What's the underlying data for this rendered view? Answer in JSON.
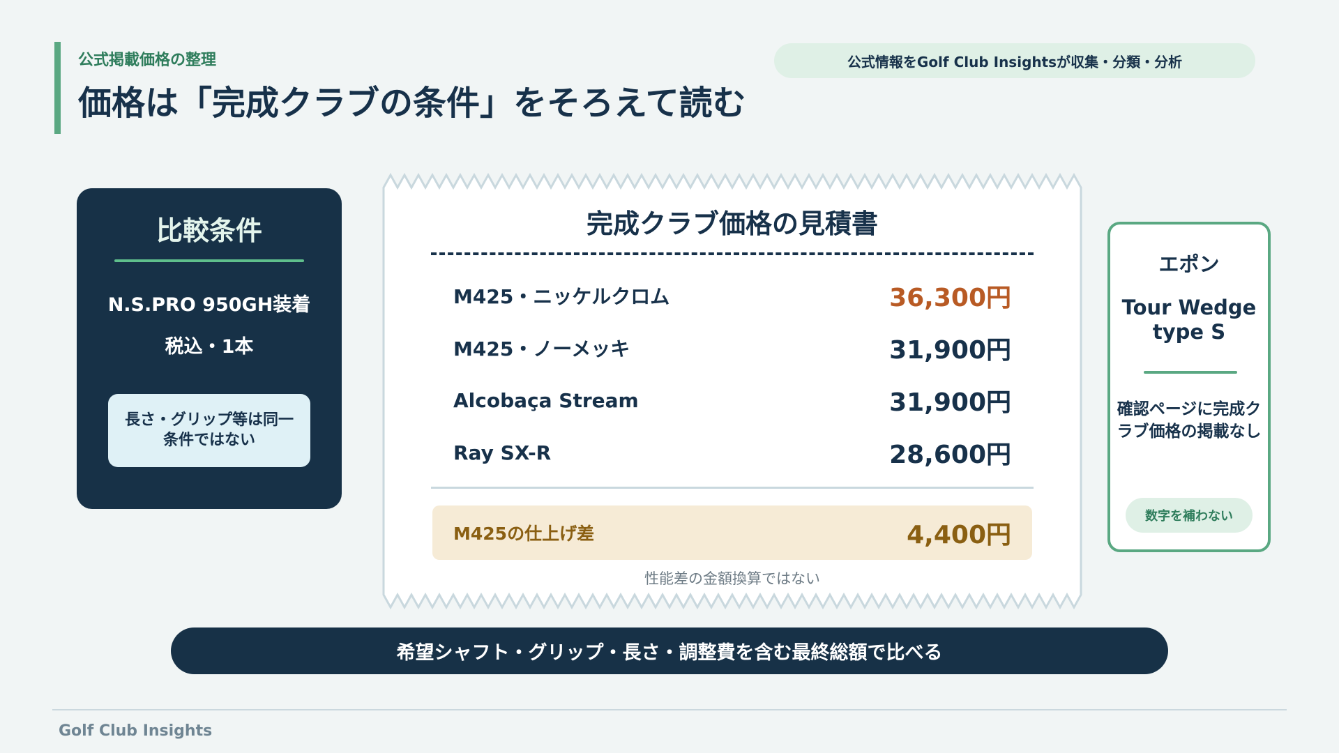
{
  "header": {
    "kicker": "公式掲載価格の整理",
    "title": "価格は「完成クラブの条件」をそろえて読む",
    "source_pill": "公式情報をGolf Club Insightsが収集・分類・分析"
  },
  "conditions": {
    "title": "比較条件",
    "lines": [
      "N.S.PRO 950GH装着",
      "税込・1本"
    ],
    "note": "長さ・グリップ等は同一条件ではない"
  },
  "receipt": {
    "title": "完成クラブ価格の見積書",
    "rows": [
      {
        "label": "M425・ニッケルクロム",
        "price": "36,300円"
      },
      {
        "label": "M425・ノーメッキ",
        "price": "31,900円"
      },
      {
        "label": "Alcobaça Stream",
        "price": "31,900円"
      },
      {
        "label": "Ray SX-R",
        "price": "28,600円"
      }
    ],
    "diff": {
      "label": "M425の仕上げ差",
      "value": "4,400円"
    },
    "diff_note": "性能差の金額換算ではない"
  },
  "epon": {
    "brand": "エポン",
    "model": "Tour Wedge type S",
    "note": "確認ページに完成クラブ価格の掲載なし",
    "badge": "数字を補わない"
  },
  "banner": "希望シャフト・グリップ・長さ・調整費を含む最終総額で比べる",
  "footer": {
    "brand": "Golf Club Insights"
  },
  "colors": {
    "navy": "#173147",
    "accent_green": "#5aa882",
    "highlight_price": "#b85a24",
    "diff_gold": "#8a5f12",
    "background": "#f1f5f5"
  }
}
